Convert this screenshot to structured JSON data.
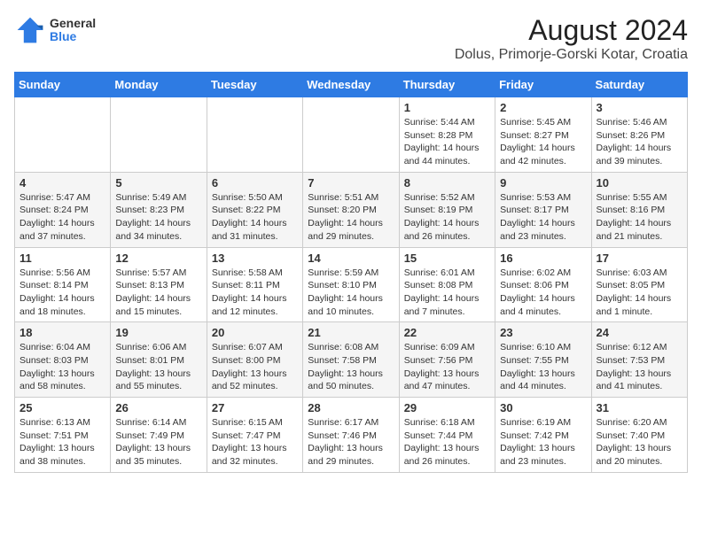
{
  "logo": {
    "general": "General",
    "blue": "Blue"
  },
  "header": {
    "month_year": "August 2024",
    "location": "Dolus, Primorje-Gorski Kotar, Croatia"
  },
  "weekdays": [
    "Sunday",
    "Monday",
    "Tuesday",
    "Wednesday",
    "Thursday",
    "Friday",
    "Saturday"
  ],
  "weeks": [
    [
      {
        "day": "",
        "content": ""
      },
      {
        "day": "",
        "content": ""
      },
      {
        "day": "",
        "content": ""
      },
      {
        "day": "",
        "content": ""
      },
      {
        "day": "1",
        "content": "Sunrise: 5:44 AM\nSunset: 8:28 PM\nDaylight: 14 hours\nand 44 minutes."
      },
      {
        "day": "2",
        "content": "Sunrise: 5:45 AM\nSunset: 8:27 PM\nDaylight: 14 hours\nand 42 minutes."
      },
      {
        "day": "3",
        "content": "Sunrise: 5:46 AM\nSunset: 8:26 PM\nDaylight: 14 hours\nand 39 minutes."
      }
    ],
    [
      {
        "day": "4",
        "content": "Sunrise: 5:47 AM\nSunset: 8:24 PM\nDaylight: 14 hours\nand 37 minutes."
      },
      {
        "day": "5",
        "content": "Sunrise: 5:49 AM\nSunset: 8:23 PM\nDaylight: 14 hours\nand 34 minutes."
      },
      {
        "day": "6",
        "content": "Sunrise: 5:50 AM\nSunset: 8:22 PM\nDaylight: 14 hours\nand 31 minutes."
      },
      {
        "day": "7",
        "content": "Sunrise: 5:51 AM\nSunset: 8:20 PM\nDaylight: 14 hours\nand 29 minutes."
      },
      {
        "day": "8",
        "content": "Sunrise: 5:52 AM\nSunset: 8:19 PM\nDaylight: 14 hours\nand 26 minutes."
      },
      {
        "day": "9",
        "content": "Sunrise: 5:53 AM\nSunset: 8:17 PM\nDaylight: 14 hours\nand 23 minutes."
      },
      {
        "day": "10",
        "content": "Sunrise: 5:55 AM\nSunset: 8:16 PM\nDaylight: 14 hours\nand 21 minutes."
      }
    ],
    [
      {
        "day": "11",
        "content": "Sunrise: 5:56 AM\nSunset: 8:14 PM\nDaylight: 14 hours\nand 18 minutes."
      },
      {
        "day": "12",
        "content": "Sunrise: 5:57 AM\nSunset: 8:13 PM\nDaylight: 14 hours\nand 15 minutes."
      },
      {
        "day": "13",
        "content": "Sunrise: 5:58 AM\nSunset: 8:11 PM\nDaylight: 14 hours\nand 12 minutes."
      },
      {
        "day": "14",
        "content": "Sunrise: 5:59 AM\nSunset: 8:10 PM\nDaylight: 14 hours\nand 10 minutes."
      },
      {
        "day": "15",
        "content": "Sunrise: 6:01 AM\nSunset: 8:08 PM\nDaylight: 14 hours\nand 7 minutes."
      },
      {
        "day": "16",
        "content": "Sunrise: 6:02 AM\nSunset: 8:06 PM\nDaylight: 14 hours\nand 4 minutes."
      },
      {
        "day": "17",
        "content": "Sunrise: 6:03 AM\nSunset: 8:05 PM\nDaylight: 14 hours\nand 1 minute."
      }
    ],
    [
      {
        "day": "18",
        "content": "Sunrise: 6:04 AM\nSunset: 8:03 PM\nDaylight: 13 hours\nand 58 minutes."
      },
      {
        "day": "19",
        "content": "Sunrise: 6:06 AM\nSunset: 8:01 PM\nDaylight: 13 hours\nand 55 minutes."
      },
      {
        "day": "20",
        "content": "Sunrise: 6:07 AM\nSunset: 8:00 PM\nDaylight: 13 hours\nand 52 minutes."
      },
      {
        "day": "21",
        "content": "Sunrise: 6:08 AM\nSunset: 7:58 PM\nDaylight: 13 hours\nand 50 minutes."
      },
      {
        "day": "22",
        "content": "Sunrise: 6:09 AM\nSunset: 7:56 PM\nDaylight: 13 hours\nand 47 minutes."
      },
      {
        "day": "23",
        "content": "Sunrise: 6:10 AM\nSunset: 7:55 PM\nDaylight: 13 hours\nand 44 minutes."
      },
      {
        "day": "24",
        "content": "Sunrise: 6:12 AM\nSunset: 7:53 PM\nDaylight: 13 hours\nand 41 minutes."
      }
    ],
    [
      {
        "day": "25",
        "content": "Sunrise: 6:13 AM\nSunset: 7:51 PM\nDaylight: 13 hours\nand 38 minutes."
      },
      {
        "day": "26",
        "content": "Sunrise: 6:14 AM\nSunset: 7:49 PM\nDaylight: 13 hours\nand 35 minutes."
      },
      {
        "day": "27",
        "content": "Sunrise: 6:15 AM\nSunset: 7:47 PM\nDaylight: 13 hours\nand 32 minutes."
      },
      {
        "day": "28",
        "content": "Sunrise: 6:17 AM\nSunset: 7:46 PM\nDaylight: 13 hours\nand 29 minutes."
      },
      {
        "day": "29",
        "content": "Sunrise: 6:18 AM\nSunset: 7:44 PM\nDaylight: 13 hours\nand 26 minutes."
      },
      {
        "day": "30",
        "content": "Sunrise: 6:19 AM\nSunset: 7:42 PM\nDaylight: 13 hours\nand 23 minutes."
      },
      {
        "day": "31",
        "content": "Sunrise: 6:20 AM\nSunset: 7:40 PM\nDaylight: 13 hours\nand 20 minutes."
      }
    ]
  ]
}
